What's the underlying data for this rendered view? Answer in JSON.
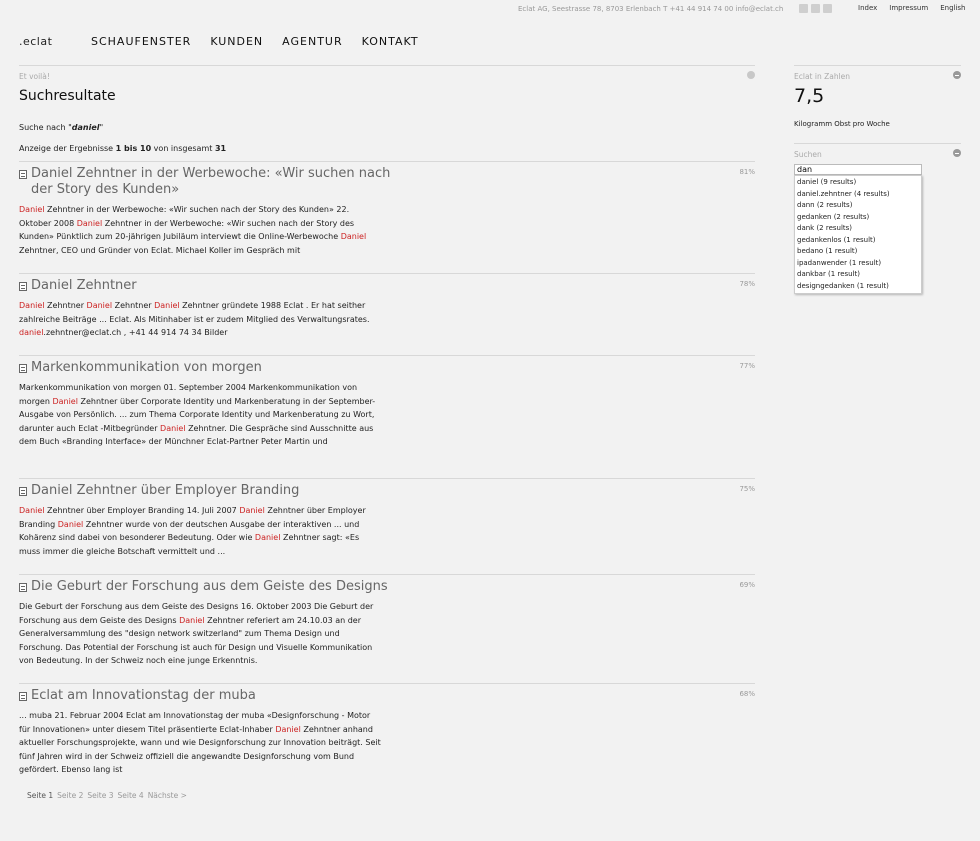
{
  "topbar": {
    "address": "Eclat AG, Seestrasse 78, 8703 Erlenbach  T +41 44 914 74 00  info@eclat.ch",
    "social_icons": [
      "twitter-icon",
      "linkedin-icon",
      "facebook-icon"
    ],
    "links": [
      "Index",
      "Impressum",
      "English"
    ]
  },
  "logo": ".eclat",
  "nav": [
    "SCHAUFENSTER",
    "KUNDEN",
    "AGENTUR",
    "KONTAKT"
  ],
  "main": {
    "eyebrow": "Et voilà!",
    "title": "Suchresultate",
    "search_prefix": "Suche nach \"",
    "search_term": "daniel",
    "search_suffix": "\"",
    "summary": {
      "prefix": "Anzeige der Ergebnisse ",
      "range": "1 bis 10",
      "middle": " von insgesamt ",
      "total": "31"
    },
    "results": [
      {
        "title": "Daniel Zehntner in der Werbewoche: «Wir suchen nach der Story des Kunden»",
        "score": "81%",
        "snippet": [
          {
            "hl": true,
            "text": "Daniel"
          },
          {
            "hl": false,
            "text": " Zehntner in der Werbewoche: «Wir suchen nach der Story des Kunden» 22. Oktober 2008 "
          },
          {
            "hl": true,
            "text": "Daniel"
          },
          {
            "hl": false,
            "text": " Zehntner in der Werbewoche: «Wir suchen nach der Story des Kunden» Pünktlich zum 20-jährigen Jubiläum interviewt die Online-Werbewoche "
          },
          {
            "hl": true,
            "text": "Daniel"
          },
          {
            "hl": false,
            "text": " Zehntner, CEO und Gründer von Eclat. Michael Koller im Gespräch mit"
          }
        ]
      },
      {
        "title": "Daniel Zehntner",
        "score": "78%",
        "snippet": [
          {
            "hl": true,
            "text": "Daniel"
          },
          {
            "hl": false,
            "text": " Zehntner "
          },
          {
            "hl": true,
            "text": "Daniel"
          },
          {
            "hl": false,
            "text": " Zehntner "
          },
          {
            "hl": true,
            "text": "Daniel"
          },
          {
            "hl": false,
            "text": " Zehntner gründete 1988 Eclat . Er hat seither zahlreiche Beiträge ... Eclat. Als Mitinhaber ist er zudem Mitglied des Verwaltungsrates. "
          },
          {
            "hl": true,
            "text": "daniel"
          },
          {
            "hl": false,
            "text": ".zehntner@eclat.ch , +41 44 914 74 34 Bilder"
          }
        ]
      },
      {
        "title": "Markenkommunikation von morgen",
        "score": "77%",
        "snippet": [
          {
            "hl": false,
            "text": "Markenkommunikation von morgen 01. September 2004 Markenkommunikation von morgen "
          },
          {
            "hl": true,
            "text": "Daniel"
          },
          {
            "hl": false,
            "text": " Zehntner über Corporate Identity und Markenberatung in der September-Ausgabe von Persönlich. ... zum Thema Corporate Identity und Markenberatung zu Wort, darunter auch Eclat -Mitbegründer "
          },
          {
            "hl": true,
            "text": "Daniel"
          },
          {
            "hl": false,
            "text": " Zehntner. Die Gespräche sind Ausschnitte aus dem Buch «Branding Interface» der Münchner Eclat-Partner Peter Martin und"
          }
        ]
      },
      {
        "title": "Daniel Zehntner über Employer Branding",
        "score": "75%",
        "snippet": [
          {
            "hl": true,
            "text": "Daniel"
          },
          {
            "hl": false,
            "text": " Zehntner über Employer Branding 14. Juli 2007 "
          },
          {
            "hl": true,
            "text": "Daniel"
          },
          {
            "hl": false,
            "text": " Zehntner über Employer Branding "
          },
          {
            "hl": true,
            "text": "Daniel"
          },
          {
            "hl": false,
            "text": " Zehntner wurde von der deutschen Ausgabe der interaktiven ... und Kohärenz sind dabei von besonderer Bedeutung. Oder wie "
          },
          {
            "hl": true,
            "text": "Daniel"
          },
          {
            "hl": false,
            "text": " Zehntner sagt: «Es muss immer die gleiche Botschaft vermittelt und ..."
          }
        ]
      },
      {
        "title": "Die Geburt der Forschung aus dem Geiste des Designs",
        "score": "69%",
        "snippet": [
          {
            "hl": false,
            "text": "Die Geburt der Forschung aus dem Geiste des Designs 16. Oktober 2003 Die Geburt der Forschung aus dem Geiste des Designs "
          },
          {
            "hl": true,
            "text": "Daniel"
          },
          {
            "hl": false,
            "text": " Zehntner referiert am 24.10.03 an der Generalversammlung des \"design network switzerland\" zum Thema Design und Forschung. Das Potential der Forschung ist auch für Design und Visuelle Kommunikation von Bedeutung. In der Schweiz noch eine junge Erkenntnis."
          }
        ]
      },
      {
        "title": "Eclat am Innovationstag der muba",
        "score": "68%",
        "snippet": [
          {
            "hl": false,
            "text": "... muba 21. Februar 2004 Eclat am Innovationstag der muba «Designforschung - Motor für Innovationen» unter diesem Titel präsentierte Eclat-Inhaber "
          },
          {
            "hl": true,
            "text": "Daniel"
          },
          {
            "hl": false,
            "text": " Zehntner anhand aktueller Forschungsprojekte, wann und wie Designforschung zur Innovation beiträgt. Seit fünf Jahren wird in der Schweiz offiziell die angewandte Designforschung vom Bund gefördert. Ebenso lang ist"
          }
        ]
      }
    ],
    "pager": [
      "Seite 1",
      "Seite 2",
      "Seite 3",
      "Seite 4",
      "Nächste >"
    ]
  },
  "sidebar": {
    "zahlen_label": "Eclat in Zahlen",
    "value": "7,5",
    "caption": "Kilogramm Obst pro Woche",
    "suchen_label": "Suchen",
    "search_value": "dan",
    "suggestions": [
      "daniel (9 results)",
      "daniel.zehntner (4 results)",
      "dann (2 results)",
      "gedanken (2 results)",
      "dank (2 results)",
      "gedankenlos (1 result)",
      "bedano (1 result)",
      "ipadanwender (1 result)",
      "dankbar (1 result)",
      "designgedanken (1 result)"
    ]
  },
  "colors": {
    "background": "#f2f2f2",
    "highlight": "#cc2222",
    "muted": "#999999"
  }
}
